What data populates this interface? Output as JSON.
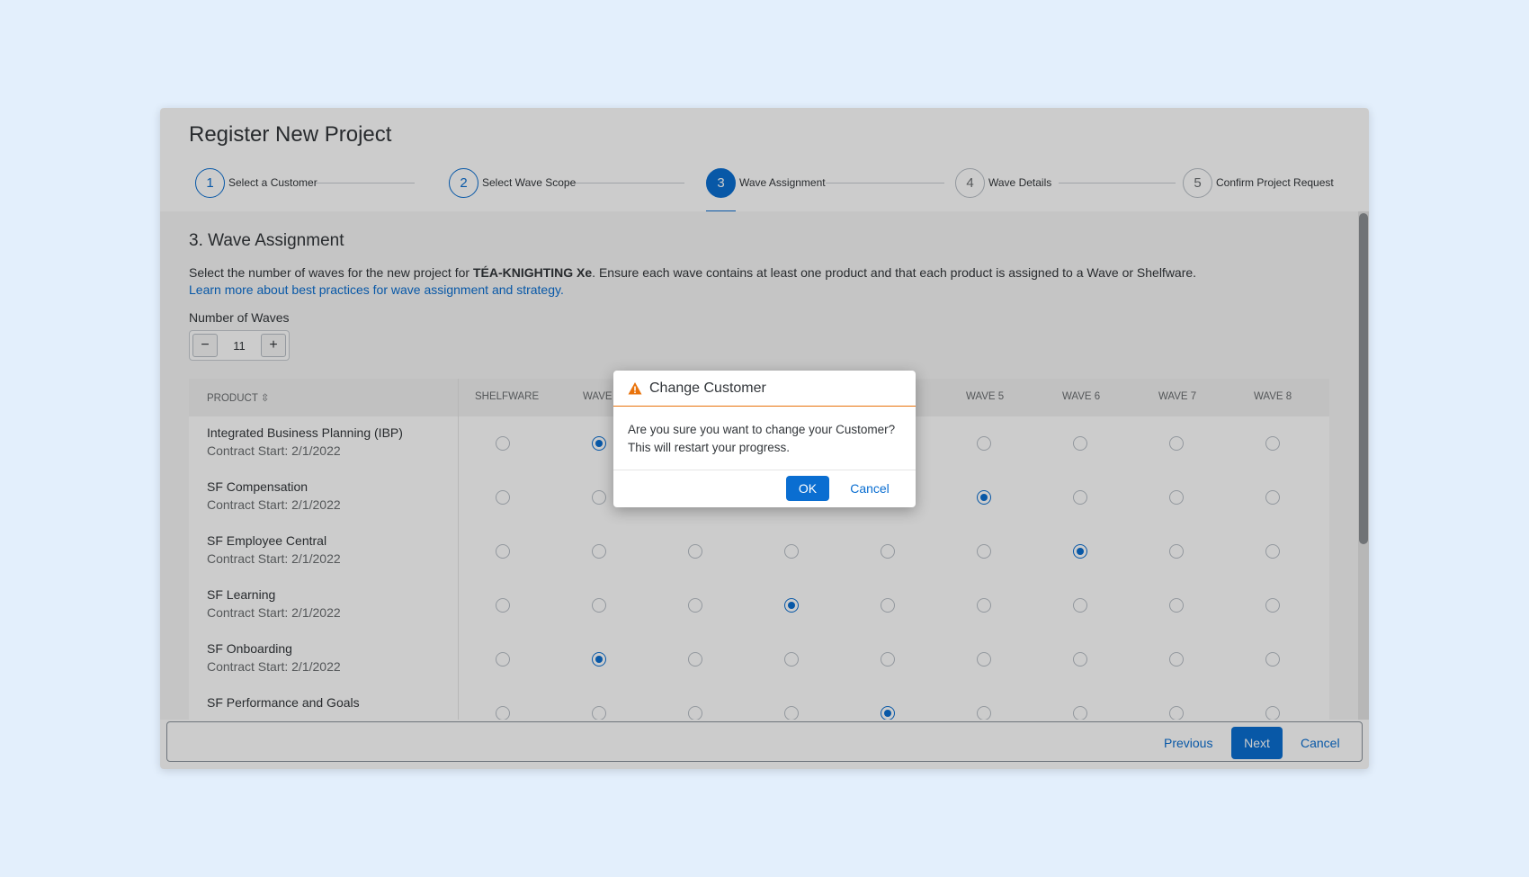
{
  "header": {
    "title": "Register New Project",
    "steps": [
      {
        "number": "1",
        "label": "Select a Customer"
      },
      {
        "number": "2",
        "label": "Select Wave Scope"
      },
      {
        "number": "3",
        "label": "Wave Assignment"
      },
      {
        "number": "4",
        "label": "Wave Details"
      },
      {
        "number": "5",
        "label": "Confirm Project Request"
      }
    ]
  },
  "content": {
    "section_title": "3. Wave Assignment",
    "desc_prefix": "Select the number of waves for the new project for ",
    "customer_name": "TÉA-KNIGHTING Xe",
    "desc_suffix": ". Ensure each wave contains at least one product and that each product is assigned to a Wave or Shelfware.",
    "learn_link": "Learn more about best practices for wave assignment and strategy.",
    "waves_label": "Number of Waves",
    "waves_value": "11",
    "minus_symbol": "−",
    "plus_symbol": "+"
  },
  "table": {
    "columns": [
      "PRODUCT",
      "SHELFWARE",
      "WAVE",
      "WAVE 5",
      "WAVE 6",
      "WAVE 7",
      "WAVE 8"
    ],
    "sort_icon": "⇳",
    "rows": [
      {
        "name": "Integrated Business Planning (IBP)",
        "sub": "Contract Start: 2/1/2022",
        "selected": 1
      },
      {
        "name": "SF Compensation",
        "sub": "Contract Start: 2/1/2022",
        "selected": 5
      },
      {
        "name": "SF Employee Central",
        "sub": "Contract Start: 2/1/2022",
        "selected": 6
      },
      {
        "name": "SF Learning",
        "sub": "Contract Start: 2/1/2022",
        "selected": 3
      },
      {
        "name": "SF Onboarding",
        "sub": "Contract Start: 2/1/2022",
        "selected": 1
      },
      {
        "name": "SF Performance and Goals",
        "sub": "",
        "selected": 4
      }
    ]
  },
  "footer": {
    "previous": "Previous",
    "next": "Next",
    "cancel": "Cancel"
  },
  "modal": {
    "title": "Change Customer",
    "icon": "warning-icon",
    "body": "Are you sure you want to change your Customer? This will restart your progress.",
    "ok": "OK",
    "cancel": "Cancel"
  },
  "colors": {
    "accent": "#0a6ed1",
    "warning": "#e9730c"
  }
}
